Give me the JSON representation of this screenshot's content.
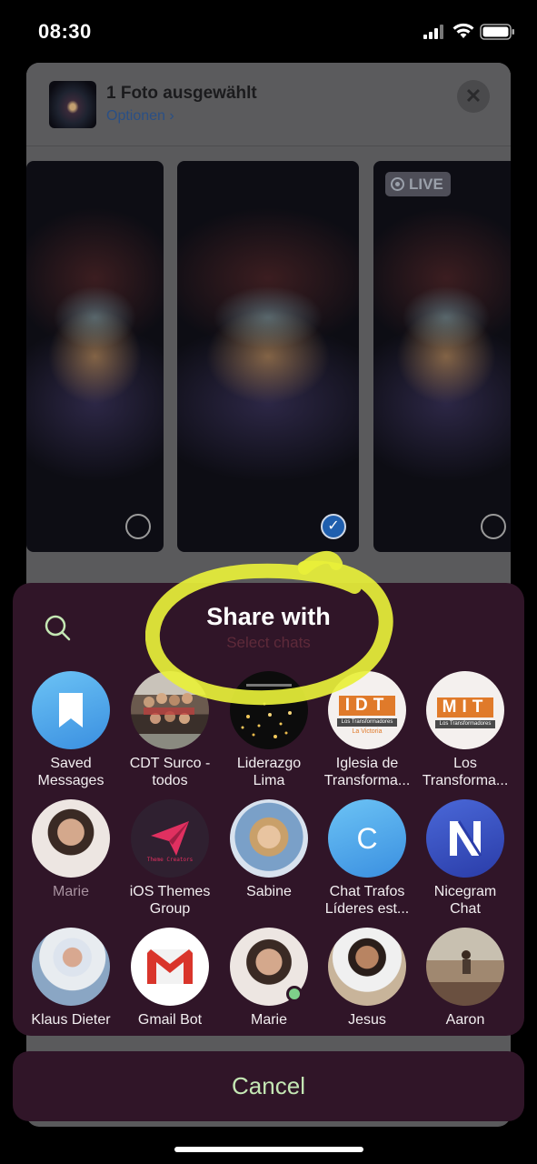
{
  "status_bar": {
    "time": "08:30"
  },
  "picker": {
    "title": "1 Foto ausgewählt",
    "options_label": "Optionen",
    "options_chevron": "›",
    "close_label": "✕",
    "live_badge": "LIVE",
    "check_glyph": "✓",
    "photos": [
      {
        "selected": false,
        "live": false
      },
      {
        "selected": true,
        "live": false
      },
      {
        "selected": false,
        "live": true
      }
    ]
  },
  "share": {
    "title": "Share with",
    "subtitle": "Select chats",
    "contacts": [
      {
        "name_line1": "Saved",
        "name_line2": "Messages",
        "avatar": "bookmark-icon"
      },
      {
        "name_line1": "CDT Surco -",
        "name_line2": "todos",
        "avatar": "group-photo"
      },
      {
        "name_line1": "Liderazgo",
        "name_line2": "Lima",
        "avatar": "night-lights-photo"
      },
      {
        "name_line1": "Iglesia de",
        "name_line2": "Transforma...",
        "avatar": "idt-logo",
        "logo_text": "IDT",
        "logo_caption": "Los Transformadores",
        "logo_sub": "La Victoria"
      },
      {
        "name_line1": "Los",
        "name_line2": "Transforma...",
        "avatar": "mit-logo",
        "logo_text": "MIT",
        "logo_caption": "Los Transformadores"
      },
      {
        "name_line1": "Marie",
        "name_line2": "",
        "avatar": "portrait-photo",
        "muted": true
      },
      {
        "name_line1": "iOS Themes",
        "name_line2": "Group",
        "avatar": "paper-plane-logo",
        "logo_caption": "Theme Creators"
      },
      {
        "name_line1": "Sabine",
        "name_line2": "",
        "avatar": "portrait-photo"
      },
      {
        "name_line1": "Chat Trafos",
        "name_line2": "Líderes est...",
        "avatar": "letter-avatar",
        "initial": "C"
      },
      {
        "name_line1": "Nicegram",
        "name_line2": "Chat",
        "avatar": "nicegram-logo"
      },
      {
        "name_line1": "Klaus Dieter",
        "name_line2": "",
        "avatar": "portrait-photo"
      },
      {
        "name_line1": "Gmail Bot",
        "name_line2": "",
        "avatar": "gmail-logo"
      },
      {
        "name_line1": "Marie",
        "name_line2": "",
        "avatar": "portrait-photo",
        "online": true
      },
      {
        "name_line1": "Jesus",
        "name_line2": "",
        "avatar": "portrait-photo"
      },
      {
        "name_line1": "Aaron",
        "name_line2": "",
        "avatar": "beach-photo"
      }
    ]
  },
  "cancel_label": "Cancel",
  "colors": {
    "panel_bg": "#301528",
    "cancel_text": "#c4e7b4",
    "highlight": "#e8f03a",
    "accent_blue": "#4aa3e8"
  }
}
